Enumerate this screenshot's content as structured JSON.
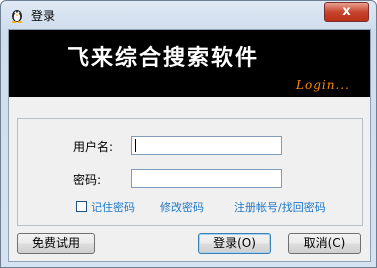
{
  "window": {
    "title": "登录",
    "close_glyph": "x",
    "app_icon": "qq-penguin-icon"
  },
  "banner": {
    "title": "飞来综合搜索软件",
    "subtitle": "Login..."
  },
  "form": {
    "username_label": "用户名:",
    "username_value": "",
    "password_label": "密码:",
    "password_value": "",
    "remember_label": "记住密码",
    "remember_checked": false,
    "change_password_link": "修改密码",
    "register_link": "注册帐号/找回密码"
  },
  "buttons": {
    "free_trial": "免费试用",
    "login": "登录(O)",
    "cancel": "取消(C)"
  },
  "colors": {
    "banner_background": "#000000",
    "banner_subtitle": "#ff8a00",
    "link": "#1e78c8",
    "close_button": "#c7452f"
  }
}
